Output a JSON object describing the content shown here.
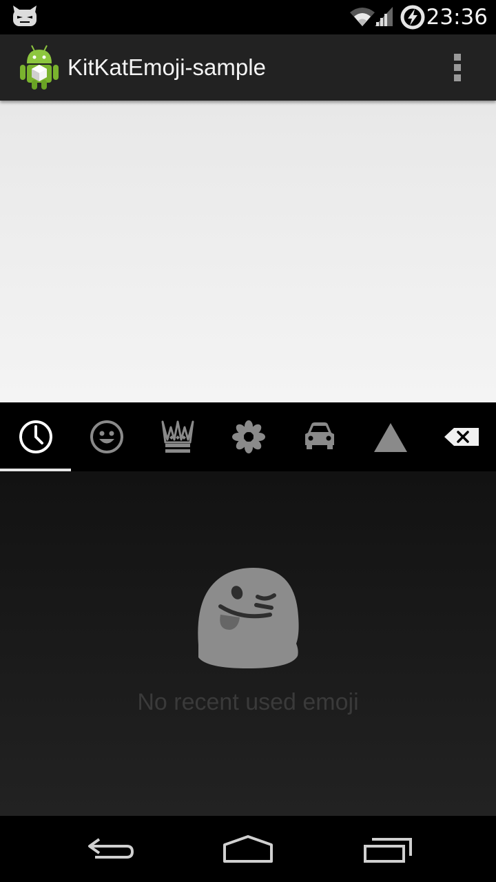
{
  "status_bar": {
    "time": "23:36",
    "icons": [
      "cyanogenmod-icon",
      "wifi-icon",
      "signal-icon",
      "battery-charging-icon"
    ]
  },
  "action_bar": {
    "title": "KitKatEmoji-sample",
    "app_icon": "android-robot-icon",
    "overflow_icon": "overflow-menu-icon"
  },
  "emoji_tabs": {
    "selected_index": 0,
    "tabs": [
      {
        "icon": "recent-clock-icon"
      },
      {
        "icon": "smiley-icon"
      },
      {
        "icon": "crown-icon"
      },
      {
        "icon": "flower-icon"
      },
      {
        "icon": "car-icon"
      },
      {
        "icon": "triangle-symbols-icon"
      },
      {
        "icon": "backspace-icon"
      }
    ]
  },
  "emoji_panel": {
    "empty_message": "No recent used emoji",
    "illustration": "winking-tongue-emoji-icon"
  },
  "nav_bar": {
    "buttons": [
      "back-icon",
      "home-icon",
      "recent-apps-icon"
    ]
  },
  "colors": {
    "action_bar_bg": "#222222",
    "content_bg": "#eeeeee",
    "tab_strip_bg": "#000000",
    "selected_tab_indicator": "#e6e6e6",
    "inactive_icon": "#8a8a8a",
    "empty_text": "#3a3a3a"
  }
}
